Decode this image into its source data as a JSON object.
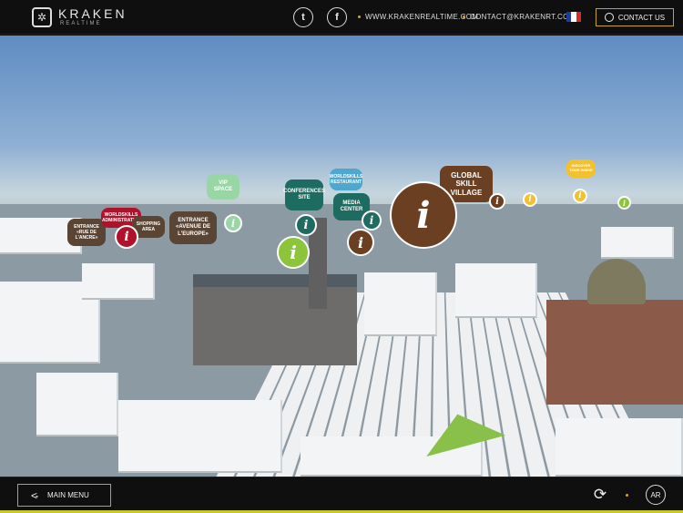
{
  "header": {
    "brand": "KRAKEN",
    "brand_sub": "REALTIME",
    "links": [
      "WWW.KRAKENREALTIME.COM",
      "CONTACT@KRAKENRT.COM"
    ],
    "contact_label": "CONTACT US"
  },
  "scene": {
    "labels": {
      "global_skill_village": "GLOBAL SKILL VILLAGE",
      "conferences_site": "CONFERENCES SITE",
      "worldskills_restaurant": "WORLDSKILLS RESTAURANT",
      "media_center": "MEDIA CENTER",
      "vip_space": "VIP SPACE",
      "entrance_europe": "ENTRANCE «AVENUE DE L'EUROPE»",
      "entrance_ancre": "ENTRANCE «RUE DE L'ANCRE»",
      "worldskills_admin": "WORLDSKILLS ADMINISTRATIVE",
      "shopping_area": "SHOPPING AREA",
      "yellow_tag": "DISCOVER TOUR INSIDE"
    },
    "info_glyph": "i"
  },
  "footer": {
    "main_menu_label": "MAIN MENU",
    "ar_label": "AR"
  },
  "colors": {
    "accent": "#c8a21a",
    "brown": "#6b3f22",
    "teal": "#1d6b61",
    "green": "#8cc43c",
    "red": "#b0122b",
    "sky": "#8fb0d4"
  }
}
